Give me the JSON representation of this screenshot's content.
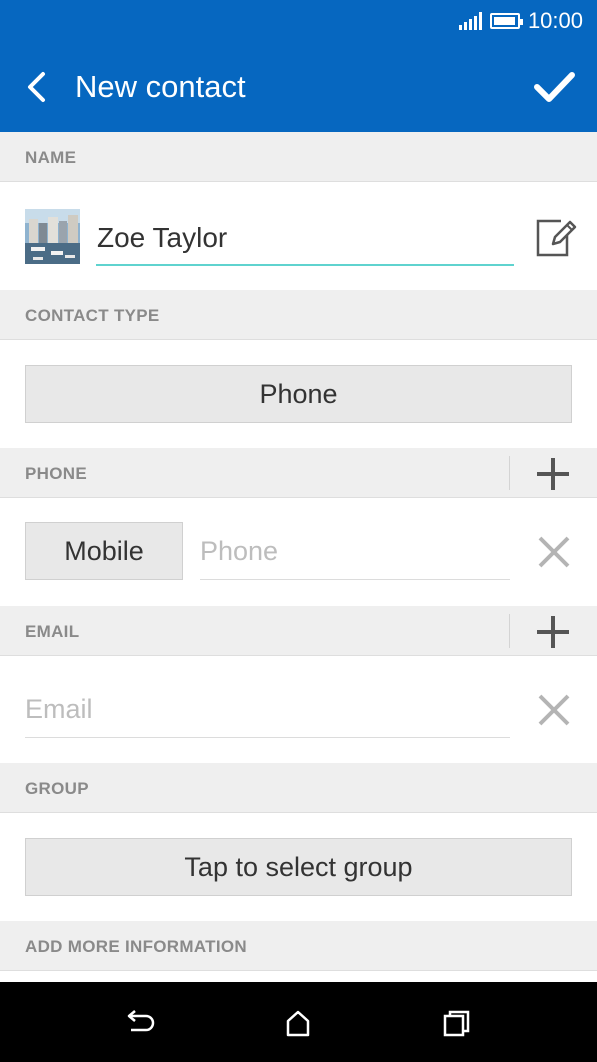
{
  "status": {
    "time": "10:00",
    "icons": [
      "signal-icon",
      "battery-icon"
    ],
    "battery_level": 0.95
  },
  "app_bar": {
    "title": "New contact",
    "background": "#0667c0",
    "back_icon": "chevron-left-icon",
    "save_icon": "checkmark-icon"
  },
  "name_section": {
    "header": "NAME",
    "name_value": "Zoe Taylor",
    "photo_icon": "contact-photo",
    "edit_icon": "edit-icon",
    "accent": "#5fd3cf"
  },
  "contact_type_section": {
    "header": "CONTACT TYPE",
    "button_label": "Phone"
  },
  "phone_section": {
    "header": "PHONE",
    "type_label": "Mobile",
    "placeholder": "Phone",
    "add_icon": "plus-icon",
    "clear_icon": "close-icon"
  },
  "email_section": {
    "header": "EMAIL",
    "placeholder": "Email",
    "add_icon": "plus-icon",
    "clear_icon": "close-icon"
  },
  "group_section": {
    "header": "GROUP",
    "button_label": "Tap to select group"
  },
  "more_section": {
    "header": "ADD MORE INFORMATION"
  },
  "nav_bar": {
    "icons": [
      "back-nav-icon",
      "home-icon",
      "recents-icon"
    ]
  }
}
